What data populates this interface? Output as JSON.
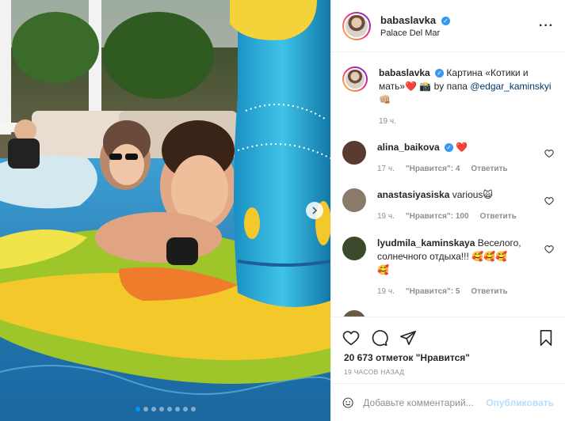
{
  "post": {
    "username": "babaslavka",
    "location": "Palace Del Mar",
    "carousel": {
      "slides": 8,
      "active": 0
    }
  },
  "caption": {
    "username": "babaslavka",
    "text": "Картина «Котики и мать»❤️ 📸 by папа",
    "mention": "@edgar_kaminskyi",
    "emoji": "👊🏼",
    "time": "19 ч."
  },
  "comments": [
    {
      "username": "alina_baikova",
      "text": "❤️",
      "time": "17 ч.",
      "likes": "\"Нравится\": 4",
      "reply": "Ответить",
      "verified": true,
      "avatar_color": "#5a3b2f"
    },
    {
      "username": "anastasiyasiska",
      "text": "various🙀",
      "time": "19 ч.",
      "likes": "\"Нравится\": 100",
      "reply": "Ответить",
      "verified": false,
      "avatar_color": "#8a7a6a"
    },
    {
      "username": "lyudmila_kaminskaya",
      "text": "Веселого, солнечного отдыха!!! 🥰🥰🥰",
      "text2": "🥰",
      "time": "19 ч.",
      "likes": "\"Нравится\": 5",
      "reply": "Ответить",
      "verified": false,
      "avatar_color": "#3a4a2a"
    }
  ],
  "actions": {
    "like_icon": "heart-icon",
    "comment_icon": "comment-icon",
    "share_icon": "paper-plane-icon",
    "save_icon": "bookmark-icon"
  },
  "likes": {
    "count": "20 673",
    "label": "отметок \"Нравится\""
  },
  "timestamp": "19 ЧАСОВ НАЗАД",
  "comment_box": {
    "emoji_icon": "smiley-icon",
    "placeholder": "Добавьте комментарий...",
    "publish_label": "Опубликовать"
  },
  "colors": {
    "accent": "#0095f6",
    "publish_disabled": "#b2dffc",
    "verified": "#3897f0"
  }
}
